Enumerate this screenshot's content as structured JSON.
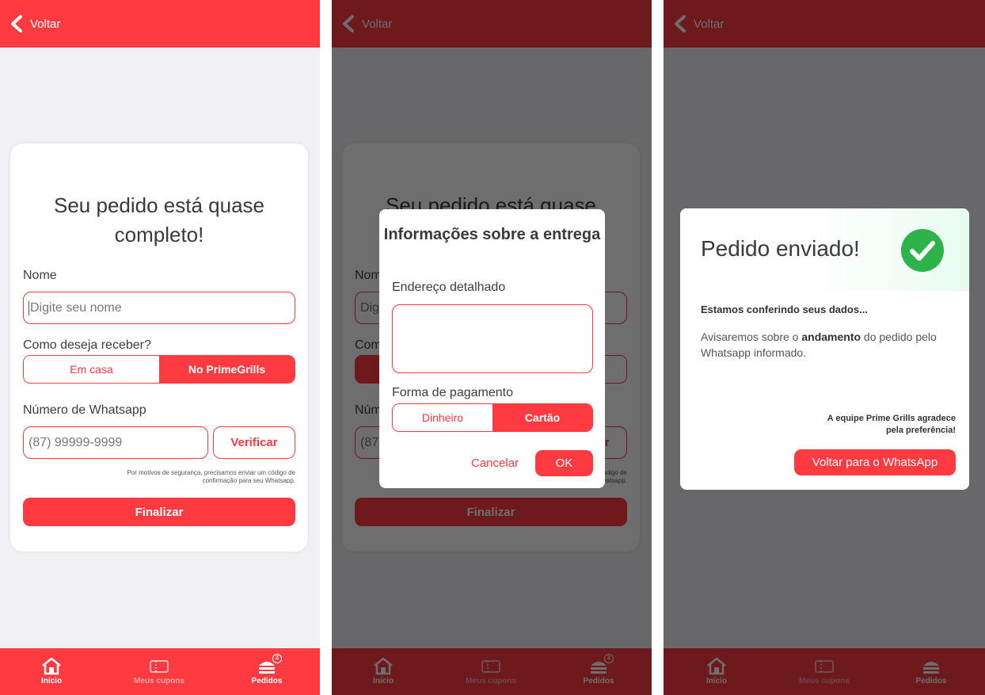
{
  "colors": {
    "brand": "#ff3a41",
    "success": "#2db34a",
    "background": "#f1f1f5"
  },
  "topbar": {
    "back_label": "Voltar"
  },
  "nav": {
    "home": "Início",
    "coupons": "Meus cupons",
    "orders": "Pedidos",
    "orders_badge": "2"
  },
  "form": {
    "title": "Seu pedido está quase completo!",
    "name_label": "Nome",
    "name_placeholder": "Digite seu nome",
    "receive_label": "Como deseja receber?",
    "option_home": "Em casa",
    "option_store": "No PrimeGrills",
    "selected_option": "No PrimeGrills",
    "whatsapp_label": "Número de Whatsapp",
    "whatsapp_placeholder": "(87) 99999-9999",
    "verify_button": "Verificar",
    "security_note": "Por motivos de segurança, precisamos enviar um código de confirmação para seu Whatsapp.",
    "finish_button": "Finalizar"
  },
  "delivery_dialog": {
    "title": "Informações sobre a entrega",
    "address_label": "Endereço detalhado",
    "payment_label": "Forma de pagamento",
    "option_cash": "Dinheiro",
    "option_card": "Cartão",
    "selected_payment": "Cartão",
    "cancel_button": "Cancelar",
    "ok_button": "OK"
  },
  "success_dialog": {
    "title": "Pedido enviado!",
    "subtitle": "Estamos conferindo seus dados...",
    "body_before": "Avisaremos sobre o ",
    "body_bold": "andamento",
    "body_after": " do pedido pelo Whatsapp informado.",
    "signature_line1": "A equipe Prime Grills agradece",
    "signature_line2": "pela preferência!",
    "back_button": "Voltar para o WhatsApp"
  }
}
